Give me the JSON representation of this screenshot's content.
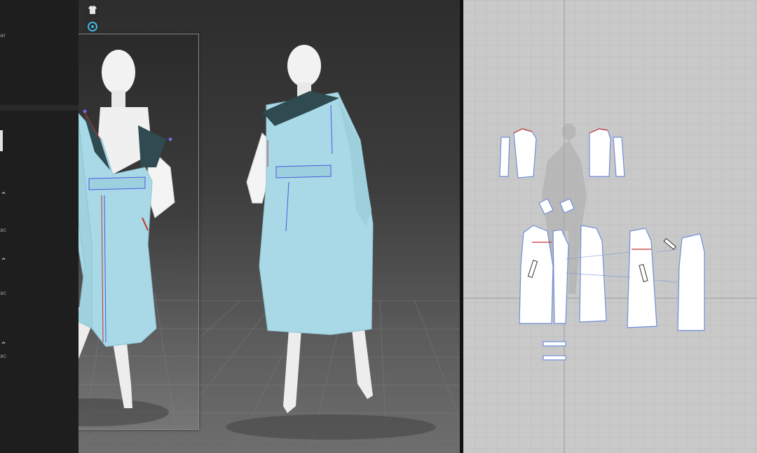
{
  "app": {
    "panel_labels": [
      "ar",
      "ac",
      "ac",
      "ac"
    ]
  },
  "viewport3d": {
    "toolbar": [
      {
        "icon": "garment-shirt-icon"
      },
      {
        "icon": "avatar-pose-icon"
      }
    ]
  },
  "pattern_window": {
    "pieces": [
      "sleeve-left",
      "sleeve-left-under",
      "sleeve-right",
      "sleeve-right-under",
      "collar-left",
      "collar-right",
      "front-left",
      "front-right",
      "back-left",
      "back-center",
      "back-right",
      "belt",
      "belt-loop"
    ]
  },
  "colors": {
    "fabric": "#a9d9e6",
    "collar": "#2f4a50",
    "avatar": "#f2f2f2",
    "viewport_bg": "#3a3a3a",
    "pattern_bg": "#c9c9c9",
    "seam_line": "#4a5ae0",
    "pin_red": "#c33333"
  }
}
